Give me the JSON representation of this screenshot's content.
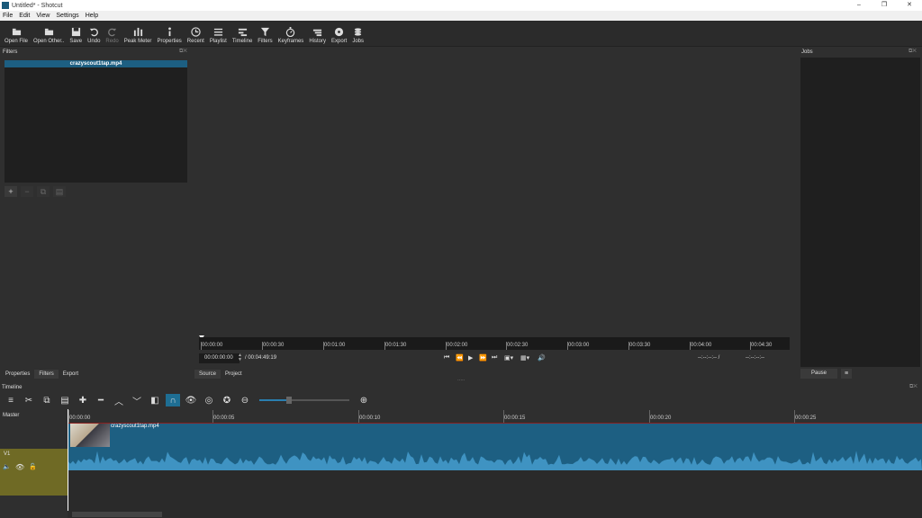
{
  "window": {
    "title": "Untitled* - Shotcut",
    "controls": [
      "–",
      "❐",
      "✕"
    ]
  },
  "menu": [
    "File",
    "Edit",
    "View",
    "Settings",
    "Help"
  ],
  "toolbar": [
    {
      "label": "Open File",
      "icon": "open-file-icon",
      "enabled": true
    },
    {
      "label": "Open Other..",
      "icon": "open-other-icon",
      "enabled": true
    },
    {
      "label": "Save",
      "icon": "save-icon",
      "enabled": true
    },
    {
      "label": "Undo",
      "icon": "undo-icon",
      "enabled": true
    },
    {
      "label": "Redo",
      "icon": "redo-icon",
      "enabled": false
    },
    {
      "label": "Peak Meter",
      "icon": "peak-meter-icon",
      "enabled": true
    },
    {
      "label": "Properties",
      "icon": "properties-icon",
      "enabled": true
    },
    {
      "label": "Recent",
      "icon": "recent-icon",
      "enabled": true
    },
    {
      "label": "Playlist",
      "icon": "playlist-icon",
      "enabled": true
    },
    {
      "label": "Timeline",
      "icon": "timeline-icon",
      "enabled": true
    },
    {
      "label": "Filters",
      "icon": "filters-icon",
      "enabled": true
    },
    {
      "label": "Keyframes",
      "icon": "keyframes-icon",
      "enabled": true
    },
    {
      "label": "History",
      "icon": "history-icon",
      "enabled": true
    },
    {
      "label": "Export",
      "icon": "export-icon",
      "enabled": true
    },
    {
      "label": "Jobs",
      "icon": "jobs-icon",
      "enabled": true
    }
  ],
  "filters_panel": {
    "title": "Filters",
    "clip_name": "crazyscout1tap.mp4",
    "tabs": [
      "Properties",
      "Filters",
      "Export"
    ],
    "active_tab": "Filters"
  },
  "viewer": {
    "ruler_ticks": [
      "00:00:00",
      "00:00:30",
      "00:01:00",
      "00:01:30",
      "00:02:00",
      "00:02:30",
      "00:03:00",
      "00:03:30",
      "00:04:00",
      "00:04:30"
    ],
    "timecode": "00:00:00:00",
    "duration": "/ 00:04:49:19",
    "in_point": "--:--:--:-- /",
    "out_point": "--:--:--:--",
    "tabs": [
      "Source",
      "Project"
    ],
    "active_tab": "Source"
  },
  "jobs_panel": {
    "title": "Jobs",
    "pause_label": "Pause",
    "menu_label": "≡"
  },
  "timeline": {
    "title": "Timeline",
    "master_label": "Master",
    "track_label": "V1",
    "ruler_ticks": [
      "00:00:00",
      "00:00:05",
      "00:00:10",
      "00:00:15",
      "00:00:20",
      "00:00:25"
    ],
    "clip_name": "crazyscout1tap.mp4"
  },
  "colors": {
    "accent": "#1d5f82",
    "track": "#6f6a25",
    "playhead_line": "#8a2020"
  }
}
